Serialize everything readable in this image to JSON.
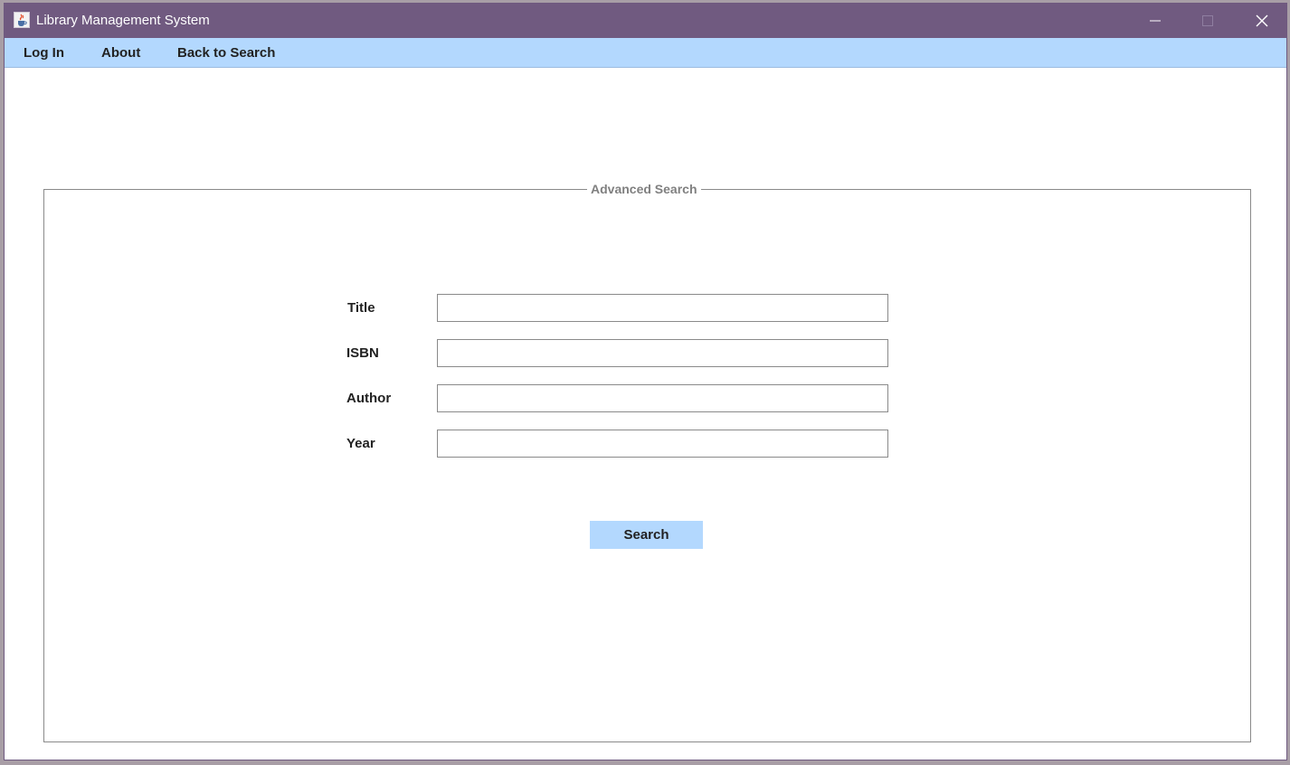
{
  "window": {
    "title": "Library Management System",
    "icon": "java-cup-icon"
  },
  "controls": {
    "minimize_icon": "minimize-icon",
    "maximize_icon": "maximize-icon",
    "close_icon": "close-icon"
  },
  "menu": {
    "login": "Log In",
    "about": "About",
    "back": "Back to Search"
  },
  "panel": {
    "legend": "Advanced Search",
    "fields": [
      {
        "label": "Title",
        "value": ""
      },
      {
        "label": "ISBN",
        "value": ""
      },
      {
        "label": "Author",
        "value": ""
      },
      {
        "label": "Year",
        "value": ""
      }
    ],
    "search_label": "Search"
  },
  "colors": {
    "titlebar": "#705a80",
    "menubar": "#b3d8fe",
    "button": "#b3d8fe",
    "legend_text": "#808080"
  }
}
